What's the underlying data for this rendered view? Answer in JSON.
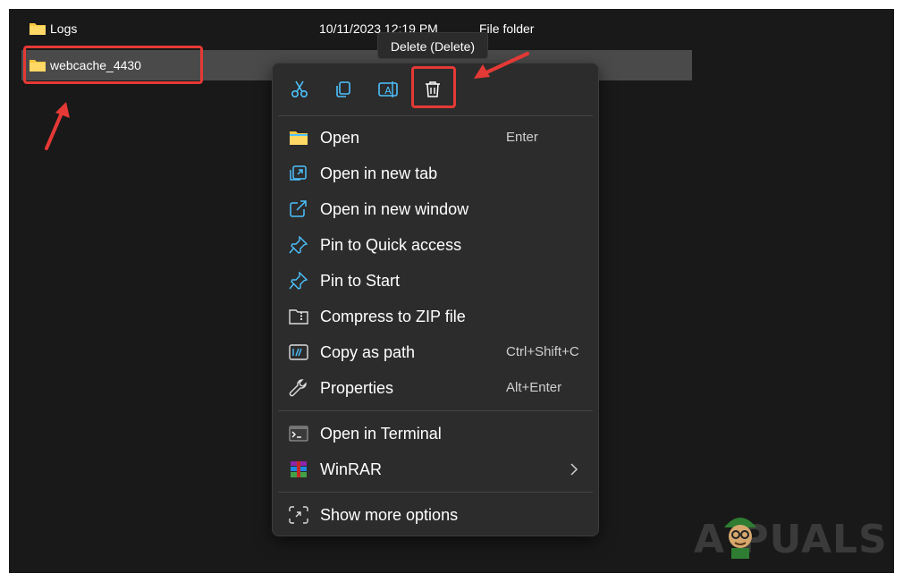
{
  "file_list": {
    "rows": [
      {
        "name": "Logs",
        "date": "10/11/2023 12:19 PM",
        "type": "File folder",
        "icon": "folder-icon"
      },
      {
        "name": "webcache_4430",
        "date": "",
        "type": "",
        "icon": "folder-icon",
        "selected": true
      }
    ]
  },
  "tooltip": {
    "text": "Delete (Delete)"
  },
  "context_menu": {
    "quick_actions": [
      {
        "name": "cut",
        "icon": "scissors-icon"
      },
      {
        "name": "copy",
        "icon": "copy-icon"
      },
      {
        "name": "rename",
        "icon": "rename-icon"
      },
      {
        "name": "delete",
        "icon": "trash-icon",
        "highlighted": true
      }
    ],
    "items": [
      {
        "label": "Open",
        "shortcut": "Enter",
        "icon": "folder-open-icon"
      },
      {
        "label": "Open in new tab",
        "shortcut": "",
        "icon": "new-tab-icon"
      },
      {
        "label": "Open in new window",
        "shortcut": "",
        "icon": "new-window-icon"
      },
      {
        "label": "Pin to Quick access",
        "shortcut": "",
        "icon": "pin-icon"
      },
      {
        "label": "Pin to Start",
        "shortcut": "",
        "icon": "pin-icon"
      },
      {
        "label": "Compress to ZIP file",
        "shortcut": "",
        "icon": "zip-icon"
      },
      {
        "label": "Copy as path",
        "shortcut": "Ctrl+Shift+C",
        "icon": "copy-path-icon"
      },
      {
        "label": "Properties",
        "shortcut": "Alt+Enter",
        "icon": "wrench-icon"
      },
      {
        "label": "Open in Terminal",
        "shortcut": "",
        "icon": "terminal-icon"
      },
      {
        "label": "WinRAR",
        "shortcut": "",
        "icon": "winrar-icon",
        "submenu": true
      },
      {
        "label": "Show more options",
        "shortcut": "",
        "icon": "more-options-icon"
      }
    ]
  },
  "watermark": {
    "text": "A  PUALS"
  },
  "colors": {
    "background": "#191919",
    "menu_bg": "#2c2c2c",
    "highlight_red": "#e53935",
    "accent_blue": "#4cc2ff",
    "folder_yellow": "#f8c73e"
  }
}
